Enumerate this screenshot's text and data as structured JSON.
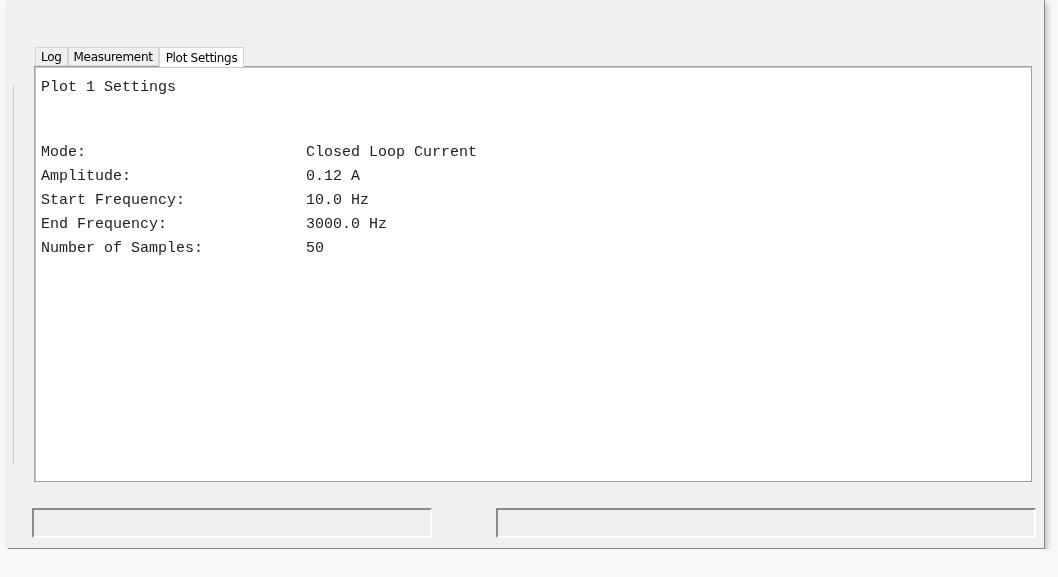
{
  "tabs": [
    {
      "label": "Log",
      "selected": false
    },
    {
      "label": "Measurement",
      "selected": false
    },
    {
      "label": "Plot Settings",
      "selected": true
    }
  ],
  "panel": {
    "title": "Plot 1 Settings",
    "rows": [
      {
        "label": "Mode:",
        "value": "Closed Loop Current"
      },
      {
        "label": "Amplitude:",
        "value": "0.12 A"
      },
      {
        "label": "Start Frequency:",
        "value": "10.0 Hz"
      },
      {
        "label": "End Frequency:",
        "value": "3000.0 Hz"
      },
      {
        "label": "Number of Samples:",
        "value": "50"
      }
    ]
  }
}
